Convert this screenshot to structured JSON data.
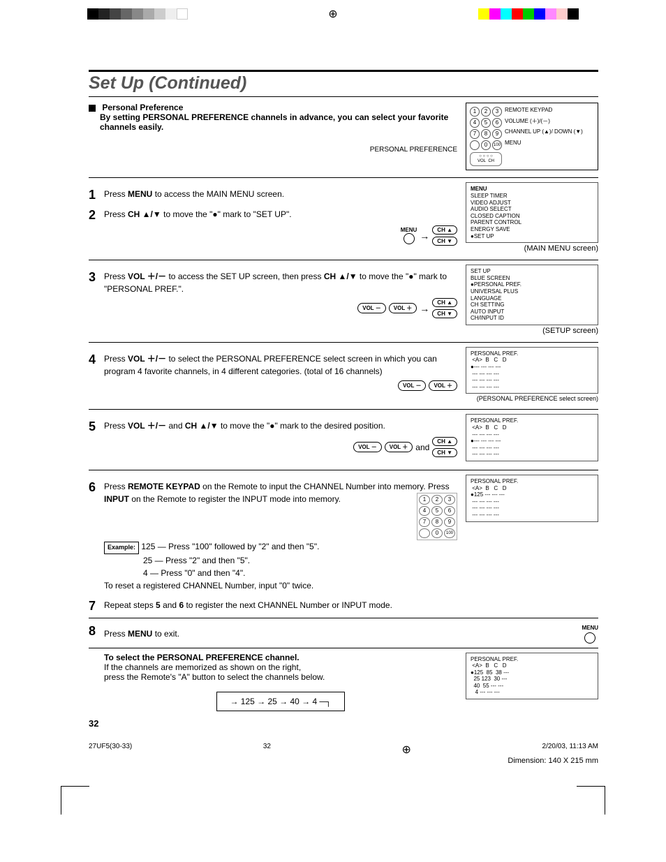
{
  "title": "Set Up (Continued)",
  "pref_heading": "Personal Preference",
  "pref_desc": "By setting PERSONAL PREFERENCE channels in advance, you can select your favorite channels easily.",
  "label_personal_pref": "PERSONAL PREFERENCE",
  "remote_labels": {
    "keypad": "REMOTE KEYPAD",
    "volume": "VOLUME (＋)/(－)",
    "channel": "CHANNEL UP (▲)/ DOWN (▼)",
    "menu": "MENU"
  },
  "steps": {
    "s1": {
      "num": "1",
      "text_a": "Press ",
      "b1": "MENU",
      "text_b": " to access the MAIN MENU screen."
    },
    "s2": {
      "num": "2",
      "text_a": "Press ",
      "b1": "CH ▲/▼",
      "text_b": " to move the \"●\" mark to \"SET UP\"."
    },
    "s3": {
      "num": "3",
      "text_a": "Press ",
      "b1": "VOL ＋/－",
      "text_b": " to access the SET UP screen, then press ",
      "b2": "CH ▲/▼",
      "text_c": " to move the \"●\" mark to \"PERSONAL PREF.\"."
    },
    "s4": {
      "num": "4",
      "text_a": "Press ",
      "b1": "VOL ＋/－",
      "text_b": " to select the PERSONAL PREFERENCE select screen in which you can program 4 favorite channels, in 4 different categories. (total of 16 channels)"
    },
    "s5": {
      "num": "5",
      "text_a": "Press ",
      "b1": "VOL ＋/－",
      "text_b": " and ",
      "b2": "CH ▲/▼",
      "text_c": " to move the \"●\" mark to the desired position."
    },
    "s6": {
      "num": "6",
      "text_a": "Press ",
      "b1": "REMOTE KEYPAD",
      "text_b": " on the Remote to input the CHANNEL Number into memory. Press ",
      "b2": "INPUT",
      "text_c": " on the Remote to register the INPUT mode into memory."
    },
    "s6_example_label": "Example:",
    "s6_ex1": "125 — Press \"100\" followed by \"2\" and then \"5\".",
    "s6_ex2": "25 — Press \"2\" and then \"5\".",
    "s6_ex3": "4   — Press \"0\" and then \"4\".",
    "s6_reset": "To reset a registered CHANNEL Number, input \"0\" twice.",
    "s7": {
      "num": "7",
      "text_a": "Repeat steps ",
      "b1": "5",
      "text_b": " and ",
      "b2": "6",
      "text_c": " to register the next CHANNEL Number or INPUT mode."
    },
    "s8": {
      "num": "8",
      "text_a": "Press ",
      "b1": "MENU",
      "text_b": " to exit."
    }
  },
  "controls": {
    "menu": "MENU",
    "ch_up": "CH ▲",
    "ch_dn": "CH ▼",
    "vol_m": "VOL －",
    "vol_p": "VOL ＋",
    "and": "and"
  },
  "screens": {
    "main_menu_title": "MENU",
    "main_menu_items": "SLEEP TIMER\nVIDEO ADJUST\nAUDIO SELECT\nCLOSED CAPTION\nPARENT CONTROL\nENERGY SAVE\n●SET UP",
    "main_menu_caption": "(MAIN MENU screen)",
    "setup_title": "SET UP",
    "setup_items": "BLUE SCREEN\n●PERSONAL PREF.\nUNIVERSAL PLUS\nLANGUAGE\nCH SETTING\nAUTO INPUT\nCH/INPUT ID",
    "setup_caption": "(SETUP screen)",
    "pp_title": "PERSONAL PREF.",
    "pp_header": " <A>  B   C   D",
    "pp_rows_dash": "●--- --- --- ---\n --- --- --- ---\n --- --- --- ---\n --- --- --- ---",
    "pp_caption": "(PERSONAL PREFERENCE select screen)",
    "pp_rows_arrow": " --- --- --- ---\n●--- --- --- ---\n --- --- --- ---\n --- --- --- ---",
    "pp_rows_125": "●125 --- --- ---\n --- --- --- ---\n --- --- --- ---\n --- --- --- ---",
    "pp_rows_final": "●125  85  38 ---\n  25 123  30 ---\n  40  55 --- ---\n   4 --- --- ---"
  },
  "select_section": {
    "title": "To select the PERSONAL PREFERENCE channel.",
    "line1": "If the channels are memorized as shown on the right,",
    "line2": "press the Remote's \"A\" button to select the channels below.",
    "cycle": "→ 125 → 25 → 40 → 4 ─┐"
  },
  "page_number": "32",
  "footer": {
    "left": "27UF5(30-33)",
    "mid": "32",
    "right": "2/20/03, 11:13 AM",
    "dim": "Dimension: 140  X 215 mm"
  }
}
